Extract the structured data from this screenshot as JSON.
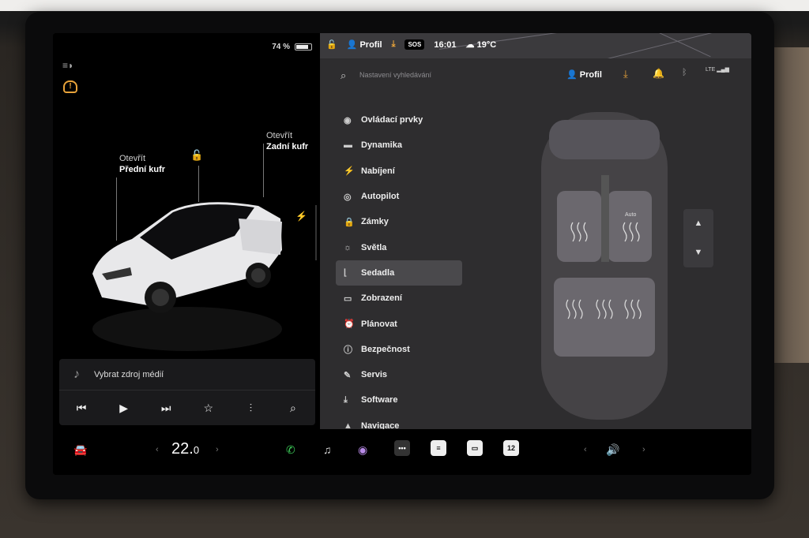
{
  "status": {
    "battery_percent": "74 %",
    "battery_level": 0.74,
    "profile": "Profil",
    "sos": "SOS",
    "time": "16:01",
    "weather": "19°C"
  },
  "car": {
    "frunk_line1": "Otevřít",
    "frunk_line2": "Přední kufr",
    "trunk_line1": "Otevřít",
    "trunk_line2": "Zadní kufr"
  },
  "media": {
    "source_label": "Vybrat zdroj médií"
  },
  "settings": {
    "search_placeholder": "Nastavení vyhledávání",
    "profile_label": "Profil",
    "lte": "LTE",
    "menu": [
      {
        "label": "Ovládací prvky",
        "icon": "toggle-icon",
        "glyph": "◉"
      },
      {
        "label": "Dynamika",
        "icon": "car-icon",
        "glyph": "▬"
      },
      {
        "label": "Nabíjení",
        "icon": "bolt-icon",
        "glyph": "⚡"
      },
      {
        "label": "Autopilot",
        "icon": "steering-wheel-icon",
        "glyph": "◎"
      },
      {
        "label": "Zámky",
        "icon": "lock-icon",
        "glyph": "🔒"
      },
      {
        "label": "Světla",
        "icon": "sun-icon",
        "glyph": "☼"
      },
      {
        "label": "Sedadla",
        "icon": "seat-icon",
        "glyph": "⌊"
      },
      {
        "label": "Zobrazení",
        "icon": "display-icon",
        "glyph": "▭"
      },
      {
        "label": "Plánovat",
        "icon": "alarm-icon",
        "glyph": "⏰"
      },
      {
        "label": "Bezpečnost",
        "icon": "alert-icon",
        "glyph": "ⓘ"
      },
      {
        "label": "Servis",
        "icon": "wrench-icon",
        "glyph": "✎"
      },
      {
        "label": "Software",
        "icon": "download-icon",
        "glyph": "⤓"
      },
      {
        "label": "Navigace",
        "icon": "navigation-icon",
        "glyph": "▲"
      }
    ],
    "active_index": 6,
    "seat_auto_label": "Auto"
  },
  "dock": {
    "temperature_whole": "22.",
    "temperature_decimal": "0",
    "calendar_day": "12"
  },
  "colors": {
    "accent_orange": "#e8a33a",
    "phone_green": "#3ecf5a"
  }
}
